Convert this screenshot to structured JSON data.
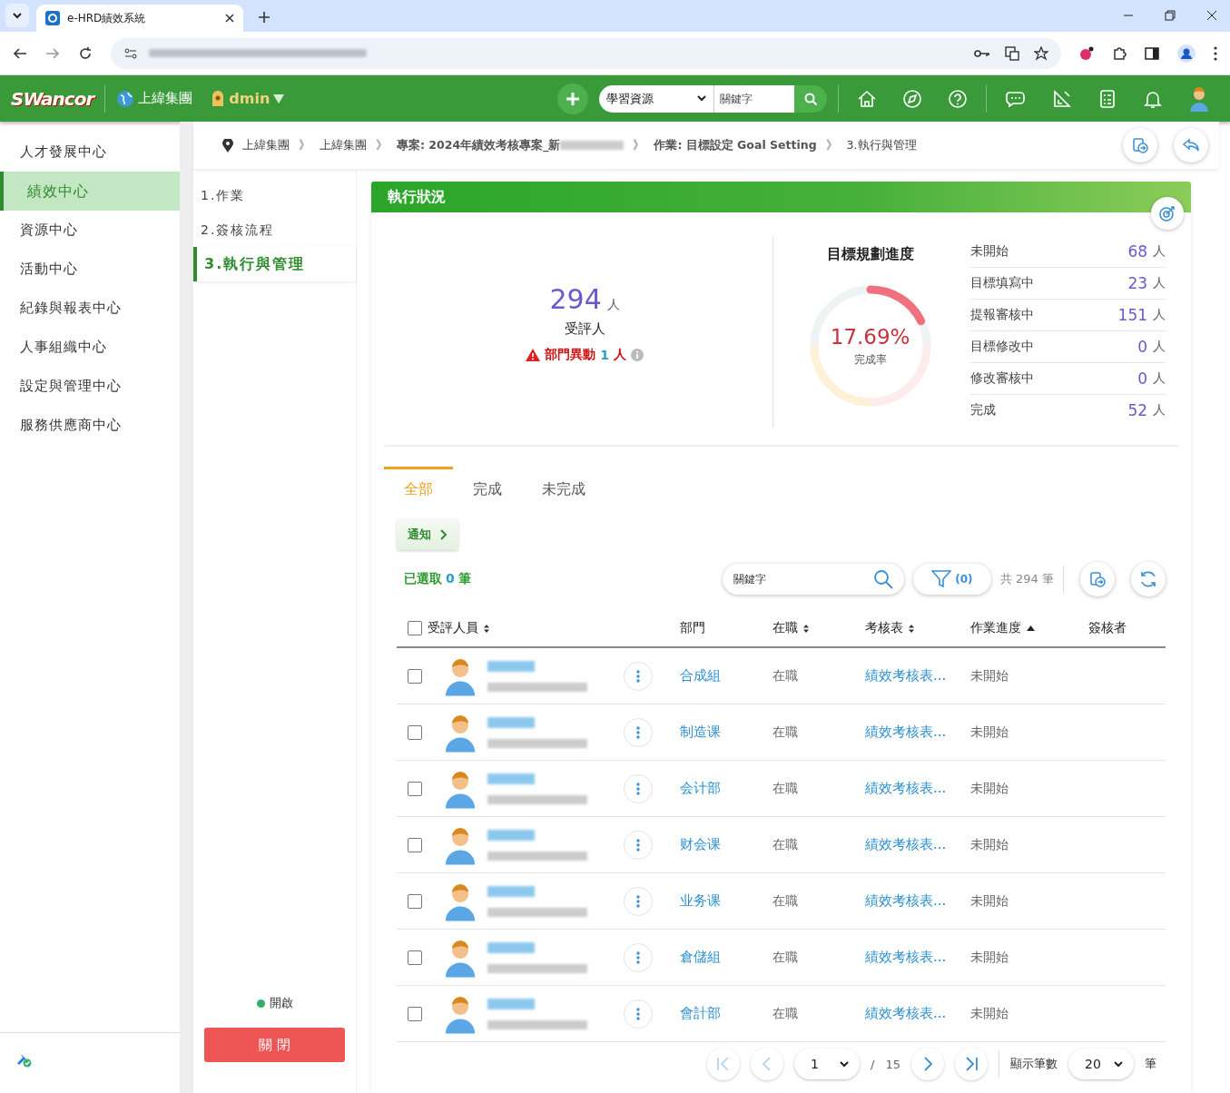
{
  "browser": {
    "tab_title": "e-HRD績效系統"
  },
  "header": {
    "logo": "SWancor",
    "org": "上緯集團",
    "user": "dmin",
    "search_category": "學習資源",
    "search_placeholder": "關鍵字"
  },
  "sidebar": {
    "items": [
      {
        "label": "人才發展中心",
        "selected": false
      },
      {
        "label": "績效中心",
        "selected": true
      },
      {
        "label": "資源中心",
        "selected": false
      },
      {
        "label": "活動中心",
        "selected": false
      },
      {
        "label": "紀錄與報表中心",
        "selected": false
      },
      {
        "label": "人事組織中心",
        "selected": false
      },
      {
        "label": "設定與管理中心",
        "selected": false
      },
      {
        "label": "服務供應商中心",
        "selected": false
      }
    ]
  },
  "breadcrumb": {
    "separator": "》",
    "items": [
      "上緯集團",
      "上緯集團",
      "專案: 2024年績效考核專案_新",
      "作業: 目標設定 Goal Setting",
      "3.執行與管理"
    ]
  },
  "steps": [
    {
      "label": "1.作業",
      "selected": false
    },
    {
      "label": "2.簽核流程",
      "selected": false
    },
    {
      "label": "3.執行與管理",
      "selected": true
    }
  ],
  "status": {
    "label": "開啟",
    "on": true
  },
  "close_button": "關 閉",
  "panel": {
    "title": "執行狀況",
    "total": "294",
    "unit": "人",
    "total_label": "受評人",
    "warning": {
      "label": "部門異動",
      "count": "1",
      "unit": "人"
    },
    "progress": {
      "title": "目標規劃進度",
      "value": "17.69%",
      "label": "完成率",
      "level": 0.1769
    },
    "stats": [
      {
        "label": "未開始",
        "value": "68",
        "unit": "人"
      },
      {
        "label": "目標填寫中",
        "value": "23",
        "unit": "人"
      },
      {
        "label": "提報審核中",
        "value": "151",
        "unit": "人"
      },
      {
        "label": "目標修改中",
        "value": "0",
        "unit": "人"
      },
      {
        "label": "修改審核中",
        "value": "0",
        "unit": "人"
      },
      {
        "label": "完成",
        "value": "52",
        "unit": "人"
      }
    ]
  },
  "tabs": [
    {
      "label": "全部",
      "selected": true
    },
    {
      "label": "完成",
      "selected": false
    },
    {
      "label": "未完成",
      "selected": false
    }
  ],
  "notify_button": "通知",
  "selection": {
    "label": "已選取",
    "count": "0",
    "unit": "筆"
  },
  "search_placeholder": "關鍵字",
  "filter_count": "(0)",
  "total_text": "共 294 筆",
  "table": {
    "select_all_checked": false,
    "columns": [
      {
        "label": "受評人員",
        "sortable": true,
        "sorted": false
      },
      {
        "label": "部門",
        "sortable": false,
        "sorted": false
      },
      {
        "label": "在職",
        "sortable": true,
        "sorted": false
      },
      {
        "label": "考核表",
        "sortable": true,
        "sorted": false
      },
      {
        "label": "作業進度",
        "sortable": true,
        "sorted": true
      },
      {
        "label": "簽核者",
        "sortable": false,
        "sorted": false
      }
    ],
    "rows": [
      {
        "checked": false,
        "dept": "合成組",
        "status": "在職",
        "form": "績效考核表...",
        "progress": "未開始"
      },
      {
        "checked": false,
        "dept": "制造课",
        "status": "在職",
        "form": "績效考核表...",
        "progress": "未開始"
      },
      {
        "checked": false,
        "dept": "会计部",
        "status": "在職",
        "form": "績效考核表...",
        "progress": "未開始"
      },
      {
        "checked": false,
        "dept": "财会课",
        "status": "在職",
        "form": "績效考核表...",
        "progress": "未開始"
      },
      {
        "checked": false,
        "dept": "业务课",
        "status": "在職",
        "form": "績效考核表...",
        "progress": "未開始"
      },
      {
        "checked": false,
        "dept": "倉儲組",
        "status": "在職",
        "form": "績效考核表...",
        "progress": "未開始"
      },
      {
        "checked": false,
        "dept": "會計部",
        "status": "在職",
        "form": "績效考核表...",
        "progress": "未開始"
      }
    ]
  },
  "pagination": {
    "page": "1",
    "separator": "/",
    "pages": "15",
    "page_size_label": "顯示筆數",
    "page_size": "20",
    "page_size_unit": "筆"
  }
}
